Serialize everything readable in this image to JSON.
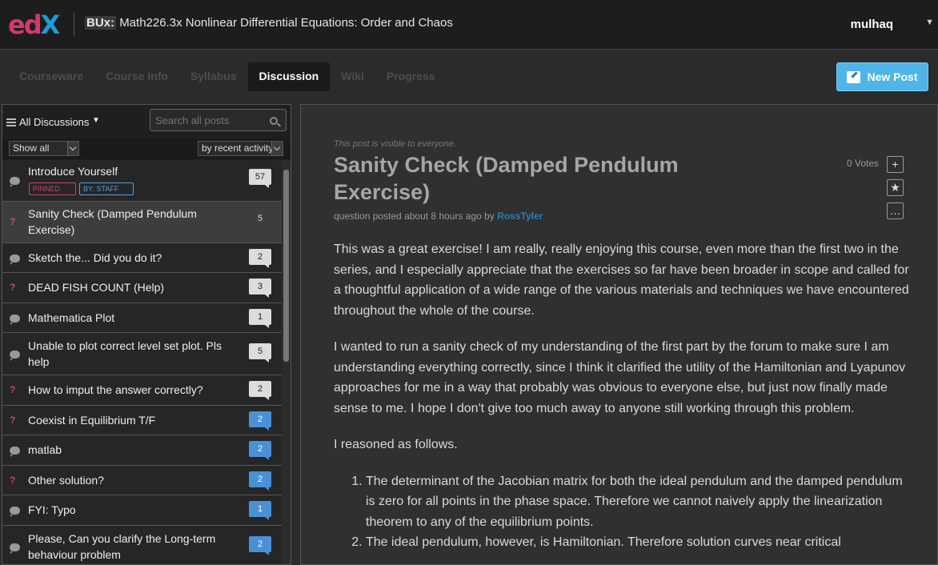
{
  "header": {
    "logo_text": "edX",
    "course_org": "BUx:",
    "course_title": "Math226.3x Nonlinear Differential Equations: Order and Chaos",
    "username": "mulhaq"
  },
  "tabs": [
    {
      "label": "Courseware"
    },
    {
      "label": "Course Info"
    },
    {
      "label": "Syllabus"
    },
    {
      "label": "Discussion",
      "active": true
    },
    {
      "label": "Wiki"
    },
    {
      "label": "Progress"
    }
  ],
  "new_post_label": "New Post",
  "sidebar": {
    "scope_label": "All Discussions",
    "search_placeholder": "Search all posts",
    "filter_show": "Show all",
    "filter_sort": "by recent activity",
    "threads": [
      {
        "type": "chat",
        "title": "Introduce Yourself",
        "count": "57",
        "tags": [
          "PINNED",
          "BY: STAFF"
        ],
        "badge": "gray"
      },
      {
        "type": "question",
        "title": "Sanity Check (Damped Pendulum Exercise)",
        "count": "5",
        "badge": "plain",
        "selected": true
      },
      {
        "type": "chat",
        "title": "Sketch the... Did you do it?",
        "count": "2",
        "badge": "gray"
      },
      {
        "type": "question",
        "title": "DEAD FISH COUNT (Help)",
        "count": "3",
        "badge": "gray"
      },
      {
        "type": "chat",
        "title": "Mathematica Plot",
        "count": "1",
        "badge": "gray"
      },
      {
        "type": "chat",
        "title": "Unable to plot correct level set plot. Pls help",
        "count": "5",
        "badge": "gray"
      },
      {
        "type": "question",
        "title": "How to imput the answer correctly?",
        "count": "2",
        "badge": "gray"
      },
      {
        "type": "question",
        "title": "Coexist in Equilibrium T/F",
        "count": "2",
        "badge": "blue"
      },
      {
        "type": "chat",
        "title": "matlab",
        "count": "2",
        "badge": "blue"
      },
      {
        "type": "question",
        "title": "Other solution?",
        "count": "2",
        "badge": "blue"
      },
      {
        "type": "chat",
        "title": "FYI: Typo",
        "count": "1",
        "badge": "blue"
      },
      {
        "type": "chat",
        "title": "Please, Can you clarify the Long-term behaviour problem",
        "count": "2",
        "badge": "blue"
      }
    ]
  },
  "post": {
    "visibility_note": "This post is visible to everyone.",
    "title": "Sanity Check (Damped Pendulum Exercise)",
    "meta_prefix": "question posted about 8 hours ago by",
    "author": "RossTyler",
    "votes": "0 Votes",
    "paragraphs": [
      "This was a great exercise! I am really, really enjoying this course, even more than the first two in the series, and I especially appreciate that the exercises so far have been broader in scope and called for a thoughtful application of a wide range of the various materials and techniques we have encountered throughout the whole of the course.",
      "I wanted to run a sanity check of my understanding of the first part by the forum to make sure I am understanding everything correctly, since I think it clarified the utility of the Hamiltonian and Lyapunov approaches for me in a way that probably was obvious to everyone else, but just now finally made sense to me. I hope I don't give too much away to anyone still working through this problem.",
      "I reasoned as follows."
    ],
    "list_items": [
      "The determinant of the Jacobian matrix for both the ideal pendulum and the damped pendulum is zero for all points in the phase space. Therefore we cannot naively apply the linearization theorem to any of the equilibrium points.",
      "The ideal pendulum, however, is Hamiltonian. Therefore solution curves near critical"
    ]
  }
}
